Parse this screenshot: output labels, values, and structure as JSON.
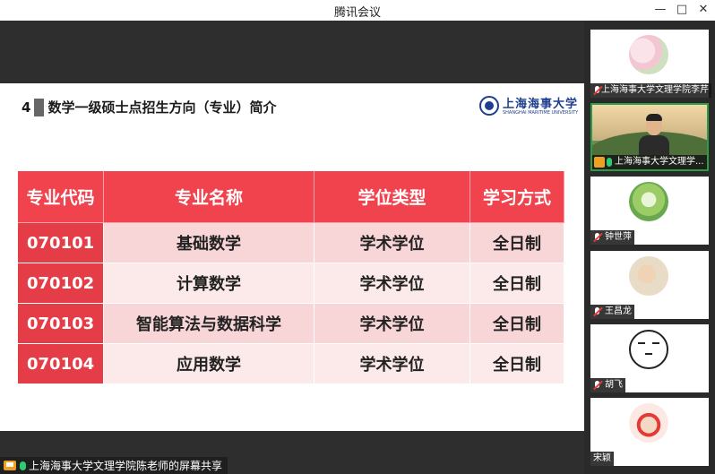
{
  "window": {
    "title": "腾讯会议",
    "controls": [
      "minimize-icon",
      "maximize-icon",
      "close-icon"
    ]
  },
  "slide": {
    "heading_number": "4",
    "heading_text": "数学一级硕士点招生方向（专业）简介",
    "logo": {
      "name_cn": "上海海事大学",
      "name_en": "SHANGHAI MARITIME UNIVERSITY"
    },
    "table": {
      "headers": [
        "专业代码",
        "专业名称",
        "学位类型",
        "学习方式"
      ],
      "rows": [
        [
          "070101",
          "基础数学",
          "学术学位",
          "全日制"
        ],
        [
          "070102",
          "计算数学",
          "学术学位",
          "全日制"
        ],
        [
          "070103",
          "智能算法与数据科学",
          "学术学位",
          "全日制"
        ],
        [
          "070104",
          "应用数学",
          "学术学位",
          "全日制"
        ]
      ]
    }
  },
  "share_bar": {
    "text": "上海海事大学文理学院陈老师的屏幕共享"
  },
  "participants": [
    {
      "name": "上海海事大学文理学院李芹",
      "mic": "muted",
      "kind": "avatar-flower"
    },
    {
      "name": "上海海事大学文理学...",
      "mic": "on",
      "kind": "video",
      "active": true
    },
    {
      "name": "钟世萍",
      "mic": "muted",
      "kind": "avatar-globe"
    },
    {
      "name": "王昌龙",
      "mic": "muted",
      "kind": "avatar-child"
    },
    {
      "name": "胡飞",
      "mic": "muted",
      "kind": "avatar-face"
    },
    {
      "name": "宋颖",
      "mic": "none",
      "kind": "avatar-girl"
    }
  ],
  "colors": {
    "table_header": "#f0434d",
    "table_code": "#e43d48",
    "row_light": "#fceaea",
    "row_dark": "#f8d5d7",
    "active_border": "#2e9b45"
  }
}
